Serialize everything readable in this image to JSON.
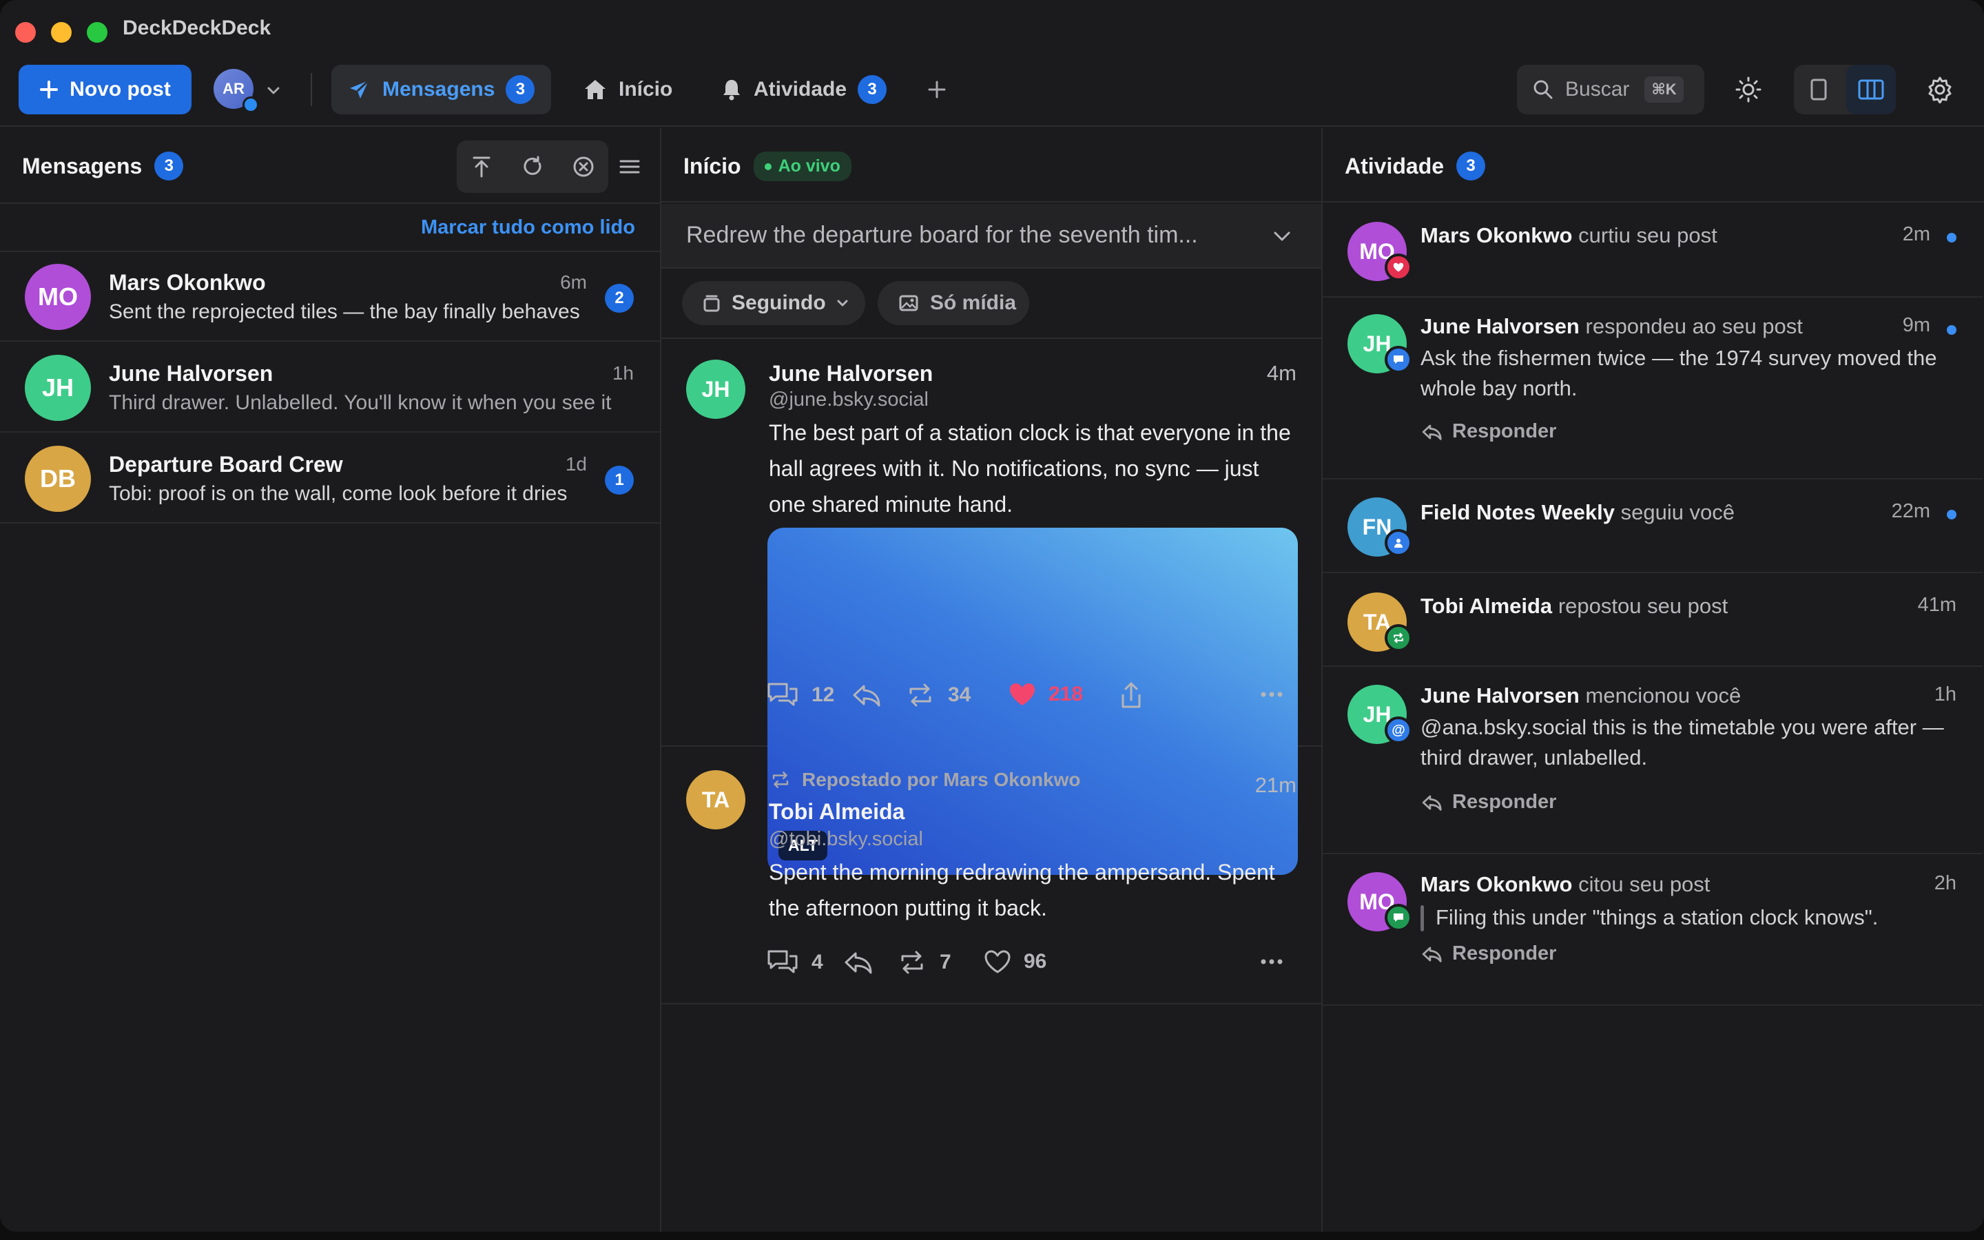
{
  "app": {
    "title": "DeckDeckDeck"
  },
  "toolbar": {
    "new_post_label": "Novo post",
    "account_initials": "AR",
    "tabs": [
      {
        "label": "Mensagens",
        "badge": "3",
        "active": true
      },
      {
        "label": "Início"
      },
      {
        "label": "Atividade",
        "badge": "3"
      }
    ],
    "search_label": "Buscar",
    "search_shortcut": "⌘K"
  },
  "messages": {
    "title": "Mensagens",
    "badge": "3",
    "mark_all_read": "Marcar tudo como lido",
    "items": [
      {
        "initials": "MO",
        "name": "Mars Okonkwo",
        "time": "6m",
        "preview": "Sent the reprojected tiles — the bay finally behaves",
        "badge": "2",
        "color": "#b04ed8"
      },
      {
        "initials": "JH",
        "name": "June Halvorsen",
        "time": "1h",
        "preview": "Third drawer. Unlabelled. You'll know it when you see it",
        "color": "#3ecc8a"
      },
      {
        "initials": "DB",
        "name": "Departure Board Crew",
        "time": "1d",
        "preview": "Tobi: proof is on the wall, come look before it dries",
        "badge": "1",
        "color": "#d8a645"
      }
    ]
  },
  "feed": {
    "title": "Início",
    "live_label": "Ao vivo",
    "compose_preview": "Redrew the departure board for the seventh tim...",
    "filters": {
      "following": "Seguindo",
      "media_only": "Só mídia"
    },
    "posts": [
      {
        "initials": "JH",
        "name": "June Halvorsen",
        "handle": "@june.bsky.social",
        "time": "4m",
        "text": "The best part of a station clock is that everyone in the hall agrees with it. No notifications, no sync — just one shared minute hand.",
        "alt_label": "ALT",
        "replies": "12",
        "reposts": "34",
        "likes": "218",
        "liked": true
      },
      {
        "initials": "TA",
        "reposted_by": "Repostado por Mars Okonkwo",
        "name": "Tobi Almeida",
        "handle": "@tobi.bsky.social",
        "time": "21m",
        "text": "Spent the morning redrawing the ampersand. Spent the afternoon putting it back.",
        "replies": "4",
        "reposts": "7",
        "likes": "96"
      }
    ]
  },
  "activity": {
    "title": "Atividade",
    "badge": "3",
    "reply_label": "Responder",
    "items": [
      {
        "initials": "MO",
        "name": "Mars Okonkwo",
        "action": "curtiu seu post",
        "time": "2m",
        "unread": true
      },
      {
        "initials": "JH",
        "name": "June Halvorsen",
        "action": "respondeu ao seu post",
        "time": "9m",
        "unread": true,
        "body": "Ask the fishermen twice — the 1974 survey moved the whole bay north."
      },
      {
        "initials": "FN",
        "name": "Field Notes Weekly",
        "action": "seguiu você",
        "time": "22m",
        "unread": true
      },
      {
        "initials": "TA",
        "name": "Tobi Almeida",
        "action": "repostou seu post",
        "time": "41m"
      },
      {
        "initials": "JH",
        "name": "June Halvorsen",
        "action": "mencionou você",
        "time": "1h",
        "body": "@ana.bsky.social this is the timetable you were after — third drawer, unlabelled."
      },
      {
        "initials": "MO",
        "name": "Mars Okonkwo",
        "action": "citou seu post",
        "time": "2h",
        "body": "Filing this under \"things a station clock knows\"."
      }
    ]
  },
  "colors": {
    "accent": "#1f6be0",
    "link": "#4a9cf6",
    "like": "#f4466c",
    "live": "#3fd07a"
  }
}
